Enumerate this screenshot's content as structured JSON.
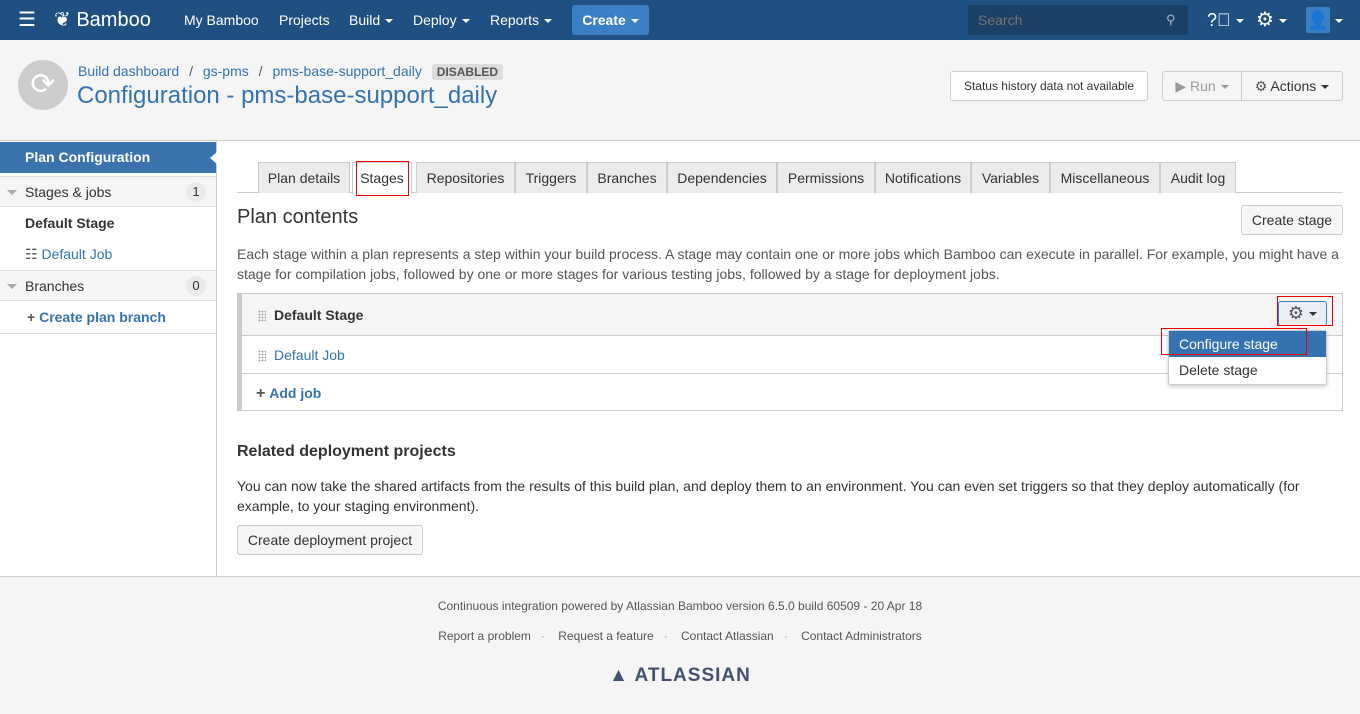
{
  "nav": {
    "app_name": "Bamboo",
    "items": [
      "My Bamboo",
      "Projects",
      "Build",
      "Deploy",
      "Reports"
    ],
    "create": "Create",
    "search_placeholder": "Search",
    "brand_color": "#205081"
  },
  "header": {
    "breadcrumb": [
      "Build dashboard",
      "gs-pms",
      "pms-base-support_daily"
    ],
    "status_lozenge": "DISABLED",
    "title": "Configuration - pms-base-support_daily",
    "status_history": "Status history data not available",
    "run": "Run",
    "actions": "Actions"
  },
  "sidebar": {
    "plan_configuration": "Plan Configuration",
    "stages_jobs": "Stages & jobs",
    "stages_count": "1",
    "default_stage": "Default Stage",
    "default_job": "Default Job",
    "branches": "Branches",
    "branches_count": "0",
    "create_branch": "Create plan branch"
  },
  "tabs": [
    "Plan details",
    "Stages",
    "Repositories",
    "Triggers",
    "Branches",
    "Dependencies",
    "Permissions",
    "Notifications",
    "Variables",
    "Miscellaneous",
    "Audit log"
  ],
  "active_tab": "Stages",
  "main": {
    "title": "Plan contents",
    "create_stage": "Create stage",
    "description": "Each stage within a plan represents a step within your build process. A stage may contain one or more jobs which Bamboo can execute in parallel. For example, you might have a stage for compilation jobs, followed by one or more stages for various testing jobs, followed by a stage for deployment jobs.",
    "stage_name": "Default Stage",
    "job_name": "Default Job",
    "add_job": "Add job",
    "menu": [
      "Configure stage",
      "Delete stage"
    ],
    "related_title": "Related deployment projects",
    "related_text": "You can now take the shared artifacts from the results of this build plan, and deploy them to an environment. You can even set triggers so that they deploy automatically (for example, to your staging environment).",
    "create_deployment": "Create deployment project"
  },
  "footer": {
    "powered": "Continuous integration powered by Atlassian Bamboo version 6.5.0 build 60509 - 20 Apr 18",
    "links": [
      "Report a problem",
      "Request a feature",
      "Contact Atlassian",
      "Contact Administrators"
    ],
    "logo": "ATLASSIAN"
  }
}
